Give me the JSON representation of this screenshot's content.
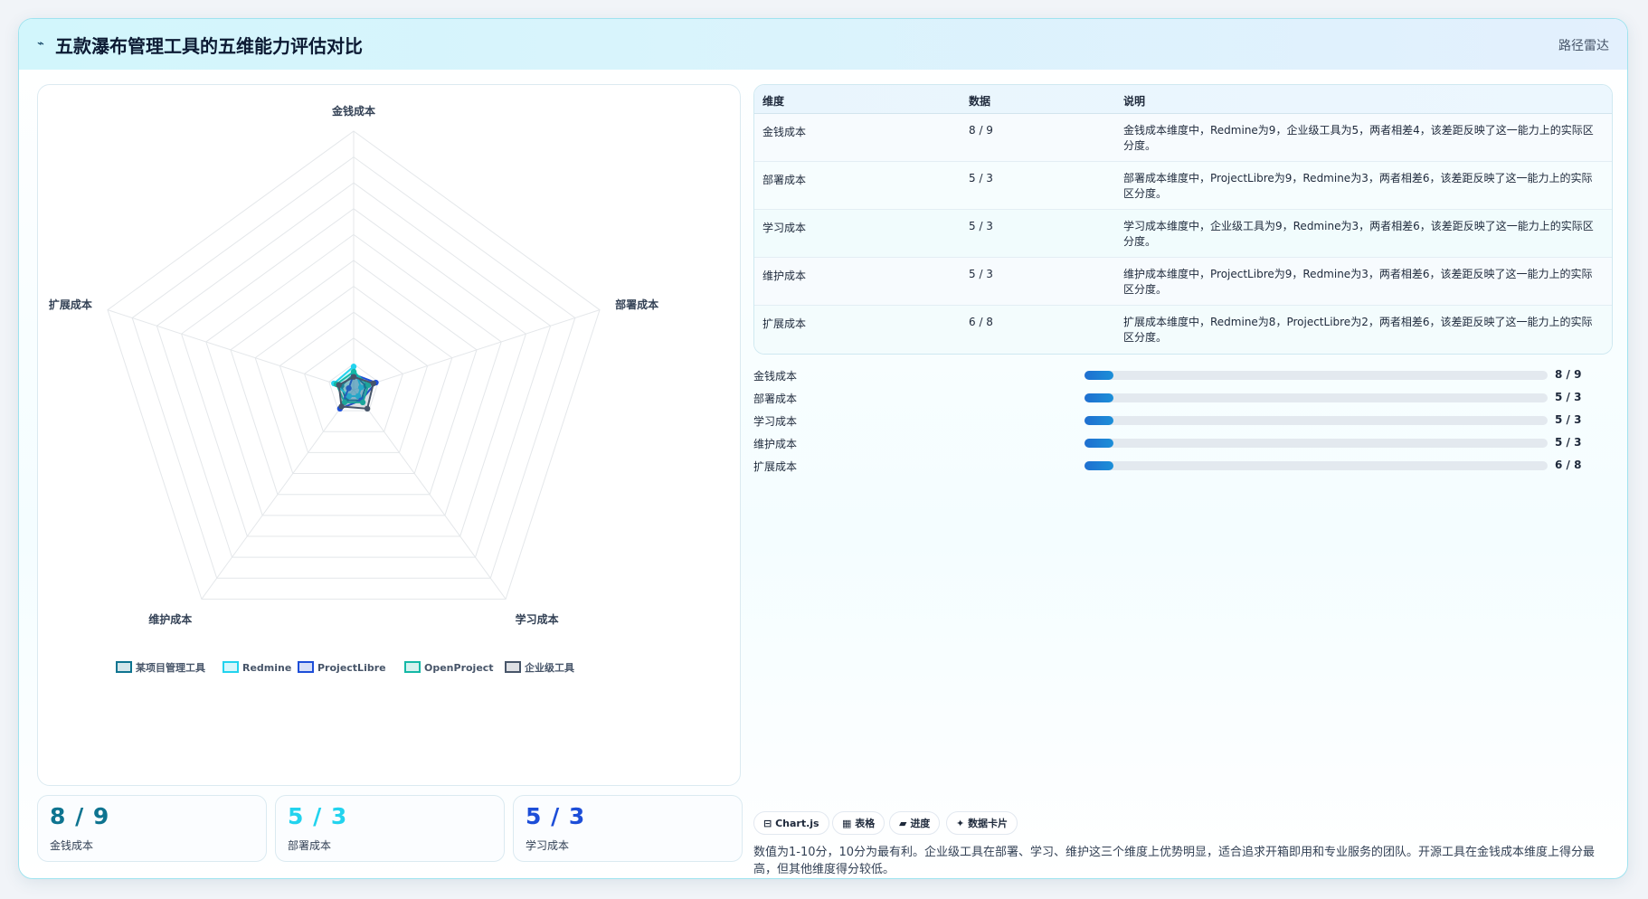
{
  "header": {
    "icon": "radar-wave-icon",
    "icon_glyph": "⌁",
    "title": "五款瀑布管理工具的五维能力评估对比",
    "tag": "路径雷达"
  },
  "chart_data": {
    "type": "radar",
    "title": "",
    "categories": [
      "金钱成本",
      "部署成本",
      "学习成本",
      "维护成本",
      "扩展成本"
    ],
    "rlim": [
      0,
      100
    ],
    "grid_levels": 10,
    "series": [
      {
        "name": "某项目管理工具",
        "values": [
          6,
          5,
          5,
          5,
          5
        ],
        "color": "#0e7490"
      },
      {
        "name": "Redmine",
        "values": [
          9,
          3,
          3,
          3,
          8
        ],
        "color": "#22d3ee"
      },
      {
        "name": "ProjectLibre",
        "values": [
          6,
          9,
          5,
          9,
          2
        ],
        "color": "#1d4ed8"
      },
      {
        "name": "OpenProject",
        "values": [
          7,
          6,
          6,
          6,
          7
        ],
        "color": "#14b8a6"
      },
      {
        "name": "企业级工具",
        "values": [
          5,
          8,
          9,
          8,
          6
        ],
        "color": "#475569"
      }
    ],
    "legend_position": "bottom"
  },
  "stats": [
    {
      "value": "8 / 9",
      "label": "金钱成本",
      "color": "#0e7490"
    },
    {
      "value": "5 / 3",
      "label": "部署成本",
      "color": "#22d3ee"
    },
    {
      "value": "5 / 3",
      "label": "学习成本",
      "color": "#1d4ed8"
    }
  ],
  "table": {
    "headers": [
      "维度",
      "数据",
      "说明"
    ],
    "rows": [
      {
        "dim": "金钱成本",
        "data": "8 / 9",
        "desc": "金钱成本维度中，Redmine为9，企业级工具为5，两者相差4，该差距反映了这一能力上的实际区分度。"
      },
      {
        "dim": "部署成本",
        "data": "5 / 3",
        "desc": "部署成本维度中，ProjectLibre为9，Redmine为3，两者相差6，该差距反映了这一能力上的实际区分度。"
      },
      {
        "dim": "学习成本",
        "data": "5 / 3",
        "desc": "学习成本维度中，企业级工具为9，Redmine为3，两者相差6，该差距反映了这一能力上的实际区分度。"
      },
      {
        "dim": "维护成本",
        "data": "5 / 3",
        "desc": "维护成本维度中，ProjectLibre为9，Redmine为3，两者相差6，该差距反映了这一能力上的实际区分度。"
      },
      {
        "dim": "扩展成本",
        "data": "6 / 8",
        "desc": "扩展成本维度中，Redmine为8，ProjectLibre为2，两者相差6，该差距反映了这一能力上的实际区分度。"
      }
    ]
  },
  "progress": [
    {
      "label": "金钱成本",
      "value": "8 / 9",
      "fill": 0.062
    },
    {
      "label": "部署成本",
      "value": "5 / 3",
      "fill": 0.062
    },
    {
      "label": "学习成本",
      "value": "5 / 3",
      "fill": 0.062
    },
    {
      "label": "维护成本",
      "value": "5 / 3",
      "fill": 0.062
    },
    {
      "label": "扩展成本",
      "value": "6 / 8",
      "fill": 0.062
    }
  ],
  "chips": [
    {
      "icon": "table-icon",
      "glyph": "⊟",
      "label": "Chart.js"
    },
    {
      "icon": "grid-icon",
      "glyph": "▦",
      "label": "表格"
    },
    {
      "icon": "progress-icon",
      "glyph": "▰",
      "label": "进度"
    },
    {
      "icon": "card-icon",
      "glyph": "✦",
      "label": "数据卡片"
    }
  ],
  "note": "数值为1-10分，10分为最有利。企业级工具在部署、学习、维护这三个维度上优势明显，适合追求开箱即用和专业服务的团队。开源工具在金钱成本维度上得分最高，但其他维度得分较低。"
}
